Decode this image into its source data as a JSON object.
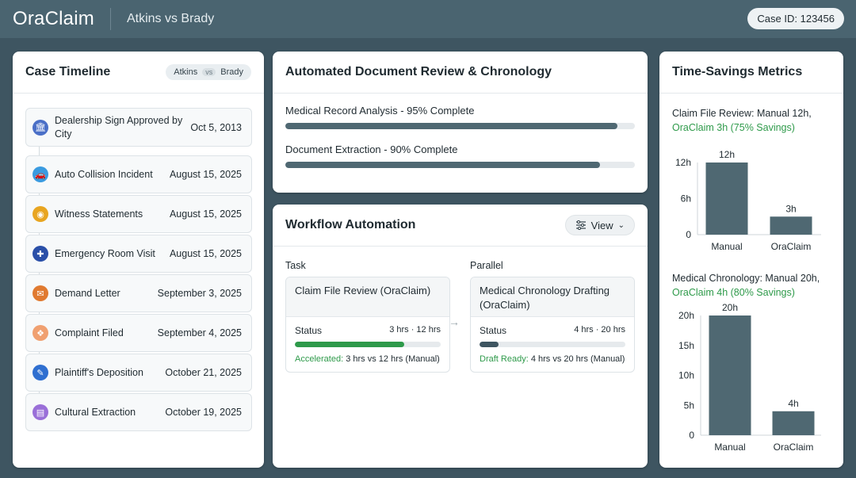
{
  "header": {
    "logo": "OraClaim",
    "case_name": "Atkins vs Brady",
    "case_id": "Case ID: 123456"
  },
  "timeline": {
    "title": "Case Timeline",
    "pill": {
      "left": "Atkins",
      "vs": "vs",
      "right": "Brady"
    },
    "items": [
      {
        "label": "Dealership Sign Approved by City",
        "date": "Oct 5, 2013",
        "icon": "building-icon",
        "color": "#4a6fc7"
      },
      {
        "label": "Auto Collision Incident",
        "date": "August 15, 2025",
        "icon": "car-icon",
        "color": "#3a9be0"
      },
      {
        "label": "Witness Statements",
        "date": "August 15, 2025",
        "icon": "eye-icon",
        "color": "#e8a520"
      },
      {
        "label": "Emergency Room Visit",
        "date": "August 15, 2025",
        "icon": "hospital-icon",
        "color": "#2a4fa8"
      },
      {
        "label": "Demand Letter",
        "date": "September 3, 2025",
        "icon": "letter-icon",
        "color": "#e07a30"
      },
      {
        "label": "Complaint Filed",
        "date": "September 4, 2025",
        "icon": "complaint-icon",
        "color": "#f0a070"
      },
      {
        "label": "Plaintiff's Deposition",
        "date": "October 21, 2025",
        "icon": "pen-icon",
        "color": "#2f6fd0"
      },
      {
        "label": "Cultural Extraction",
        "date": "October 19, 2025",
        "icon": "document-icon",
        "color": "#9a6fd8"
      }
    ]
  },
  "doc_review": {
    "title": "Automated Document Review & Chronology",
    "items": [
      {
        "label": "Medical Record Analysis - 95% Complete",
        "progress": 95
      },
      {
        "label": "Document Extraction - 90% Complete",
        "progress": 90
      }
    ]
  },
  "workflow": {
    "title": "Workflow Automation",
    "view_label": "View",
    "col_task": "Task",
    "col_parallel": "Parallel",
    "tasks": [
      {
        "title": "Claim File Review (OraClaim)",
        "status_label": "Status",
        "hrs": "3 hrs · 12 hrs",
        "progress": 75,
        "color": "#2e9a4a",
        "note_hl": "Accelerated:",
        "note": "3 hrs vs 12 hrs (Manual)"
      },
      {
        "title": "Medical Chronology Drafting (OraClaim)",
        "status_label": "Status",
        "hrs": "4 hrs · 20 hrs",
        "progress": 13,
        "color": "#3e5561",
        "note_hl": "Draft Ready:",
        "note": "4 hrs vs 20 hrs (Manual)"
      }
    ]
  },
  "metrics": {
    "title": "Time-Savings Metrics",
    "charts": [
      {
        "title_line1": "Claim File Review: Manual 12h,",
        "title_line2": "OraClaim 3h (75% Savings)"
      },
      {
        "title_line1": "Medical Chronology: Manual 20h,",
        "title_line2": "OraClaim 4h (80% Savings)"
      }
    ]
  },
  "chart_data": [
    {
      "type": "bar",
      "categories": [
        "Manual",
        "OraClaim"
      ],
      "values": [
        12,
        3
      ],
      "data_labels": [
        "12h",
        "3h"
      ],
      "yticks": [
        "0",
        "6h",
        "12h"
      ],
      "ylim": [
        0,
        12
      ],
      "color": "#4f6872"
    },
    {
      "type": "bar",
      "categories": [
        "Manual",
        "OraClaim"
      ],
      "values": [
        20,
        4
      ],
      "data_labels": [
        "20h",
        "4h"
      ],
      "yticks": [
        "0",
        "5h",
        "10h",
        "15h",
        "20h"
      ],
      "ylim": [
        0,
        20
      ],
      "color": "#4f6872"
    }
  ]
}
